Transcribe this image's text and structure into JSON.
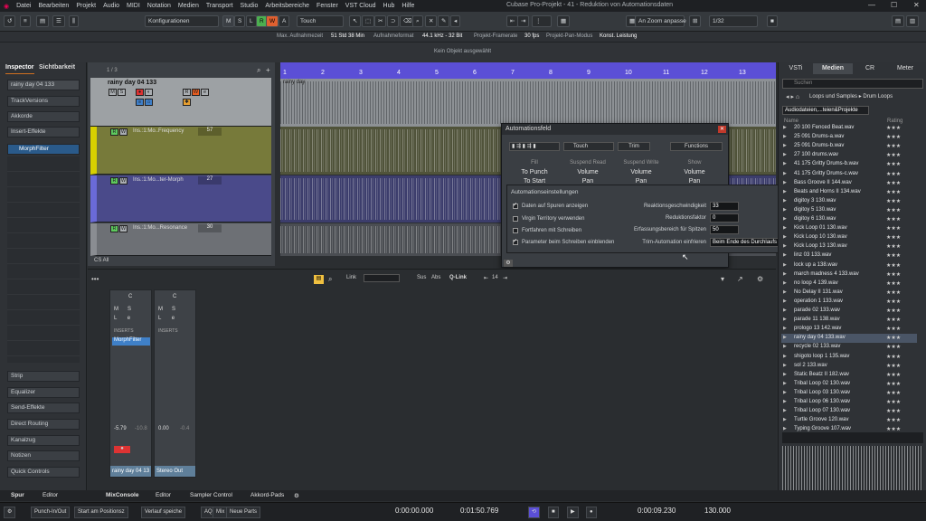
{
  "menu": {
    "items": [
      "Datei",
      "Bearbeiten",
      "Projekt",
      "Audio",
      "MIDI",
      "Notation",
      "Medien",
      "Transport",
      "Studio",
      "Arbeitsbereiche",
      "Fenster",
      "VST Cloud",
      "Hub",
      "Hilfe"
    ],
    "title": "Cubase Pro-Projekt - 41 - Reduktion von Automationsdaten"
  },
  "toolbar": {
    "config": "Konfigurationen",
    "mode_letters": [
      "M",
      "S",
      "L",
      "R",
      "W",
      "A"
    ],
    "touch": "Touch",
    "grid": "An Zoom anpasse",
    "quantize": "1/32"
  },
  "status": {
    "max_rec_label": "Max. Aufnahmezeit",
    "max_rec": "51 Std 38 Min",
    "format_label": "Aufnahmeformat",
    "format": "44.1 kHz - 32 Bit",
    "fps_label": "Projekt-Framerate",
    "fps": "30 fps",
    "pan_label": "Projekt-Pan-Modus",
    "pan": "Konst. Leistung"
  },
  "info": {
    "text": "Kein Objekt ausgewählt"
  },
  "inspector": {
    "tabs": [
      "Inspector",
      "Sichtbarkeit"
    ],
    "track_name": "rainy day 04 133",
    "sections": [
      "TrackVersions",
      "Akkorde",
      "Insert-Effekte"
    ],
    "plugin": "MorphFilter",
    "lower_sections": [
      "Strip",
      "Equalizer",
      "Send-Effekte",
      "Direct Routing",
      "Kanalzug",
      "Notizen",
      "Quick Controls"
    ]
  },
  "tracks": {
    "counter": "1 / 3",
    "main": "rainy day 04 133",
    "lanes": [
      {
        "name": "Ins.:1:Mo..Frequency",
        "value": "57"
      },
      {
        "name": "Ins.:1:Mo...ter-Morph",
        "value": "27"
      },
      {
        "name": "Ins.:1:Mo...Resonance",
        "value": "30"
      }
    ],
    "footer": "CS All"
  },
  "ruler": {
    "bars": [
      "1",
      "2",
      "3",
      "4",
      "5",
      "6",
      "7",
      "8",
      "9",
      "10",
      "11",
      "12",
      "13"
    ]
  },
  "clip_label": "rainy day",
  "automation": {
    "title": "Automationsfeld",
    "touch": "Touch",
    "trim": "Trim",
    "functions": "Functions",
    "headers": [
      "Fill",
      "Suspend Read",
      "Suspend Write",
      "Show"
    ],
    "row1": [
      "To Punch",
      "Volume",
      "Volume",
      "Volume"
    ],
    "row2": [
      "To Start",
      "Pan",
      "Pan",
      "Pan"
    ],
    "settings_title": "Automationseinstellungen",
    "checks": [
      {
        "label": "Daten auf Spuren anzeigen",
        "on": true
      },
      {
        "label": "Virgin Territory verwenden",
        "on": false
      },
      {
        "label": "Fortfahren mit Schreiben",
        "on": false
      },
      {
        "label": "Parameter beim Schreiben einblenden",
        "on": true
      }
    ],
    "fields": [
      {
        "label": "Reaktionsgeschwindigkeit",
        "value": "33"
      },
      {
        "label": "Reduktionsfaktor",
        "value": "0"
      },
      {
        "label": "Erfassungsbereich für Spitzen",
        "value": "50"
      },
      {
        "label": "Trim-Automation einfrieren",
        "value": "Beim Ende des Durchlaufs"
      }
    ]
  },
  "lower": {
    "link": "Link",
    "sus": "Sus",
    "abs": "Abs",
    "qlink": "Q-Link",
    "page": "14",
    "ch1": {
      "name": "rainy day 04 13",
      "insert": "MorphFilter",
      "vol": "-5.79",
      "peak": "-10.8",
      "pan": "C"
    },
    "ch2": {
      "name": "Stereo Out",
      "vol": "0.00",
      "peak": "-0.4",
      "pan": "C"
    },
    "inserts": "INSERTS"
  },
  "right": {
    "tabs": [
      "VSTi",
      "Medien",
      "CR",
      "Meter"
    ],
    "search": "Suchen",
    "breadcrumb": "Loops und Samples ▸ Drum Loops",
    "path": "Audiodateien,...teien&Projekte",
    "col_name": "Name",
    "col_rating": "Rating",
    "files": [
      {
        "name": "20 100 Fenced Beat.wav",
        "stars": "★★★"
      },
      {
        "name": "25 091 Drums-a.wav",
        "stars": "★★★"
      },
      {
        "name": "25 091 Drums-b.wav",
        "stars": "★★★"
      },
      {
        "name": "27 100 drums.wav",
        "stars": "★★★"
      },
      {
        "name": "41 175 Gritty Drums-b.wav",
        "stars": "★★★"
      },
      {
        "name": "41 175 Gritty Drums-c.wav",
        "stars": "★★★"
      },
      {
        "name": "Bass Groove II 144.wav",
        "stars": "★★★"
      },
      {
        "name": "Beats and Horns II 134.wav",
        "stars": "★★★"
      },
      {
        "name": "digitoy 3 130.wav",
        "stars": "★★★"
      },
      {
        "name": "digitoy 5 130.wav",
        "stars": "★★★"
      },
      {
        "name": "digitoy 6 130.wav",
        "stars": "★★★"
      },
      {
        "name": "Kick Loop 01 130.wav",
        "stars": "★★★"
      },
      {
        "name": "Kick Loop 10 130.wav",
        "stars": "★★★"
      },
      {
        "name": "Kick Loop 13 130.wav",
        "stars": "★★★"
      },
      {
        "name": "linz 03 133.wav",
        "stars": "★★★"
      },
      {
        "name": "lock up a 138.wav",
        "stars": "★★★"
      },
      {
        "name": "march madness 4 133.wav",
        "stars": "★★★"
      },
      {
        "name": "no loop 4 139.wav",
        "stars": "★★★"
      },
      {
        "name": "No Delay II 131.wav",
        "stars": "★★★"
      },
      {
        "name": "operation 1 133.wav",
        "stars": "★★★"
      },
      {
        "name": "parade 02 133.wav",
        "stars": "★★★"
      },
      {
        "name": "parade 11 138.wav",
        "stars": "★★★"
      },
      {
        "name": "prologo 13 142.wav",
        "stars": "★★★"
      },
      {
        "name": "rainy day 04 133.wav",
        "stars": "★★★"
      },
      {
        "name": "recycle 02 133.wav",
        "stars": "★★★"
      },
      {
        "name": "shigoto loop 1 135.wav",
        "stars": "★★★"
      },
      {
        "name": "sol 2 133.wav",
        "stars": "★★★"
      },
      {
        "name": "Static Beatz II 182.wav",
        "stars": "★★★"
      },
      {
        "name": "Tribal Loop 02 130.wav",
        "stars": "★★★"
      },
      {
        "name": "Tribal Loop 03 130.wav",
        "stars": "★★★"
      },
      {
        "name": "Tribal Loop 06 130.wav",
        "stars": "★★★"
      },
      {
        "name": "Tribal Loop 07 130.wav",
        "stars": "★★★"
      },
      {
        "name": "Turtle Groove 120.wav",
        "stars": "★★★"
      },
      {
        "name": "Typing Groove 107.wav",
        "stars": "★★★"
      }
    ]
  },
  "bottom_tabs": [
    "Spur",
    "Editor",
    "MixConsole",
    "Editor",
    "Sampler Control",
    "Akkord-Pads"
  ],
  "transport": {
    "punch": "Punch-In/Out",
    "start": "Start am Positionsz",
    "history": "Verlauf speiche",
    "aq": "AQ",
    "mix": "Mix",
    "newparts": "Neue Parts",
    "time1": "0:00:00.000",
    "time2": "0:01:50.769",
    "time3": "0:00:09.230",
    "tempo": "130.000"
  },
  "colors": {
    "accent": "#5b4fd6",
    "lane1": "#777a3a",
    "lane2": "#4a4a8a",
    "lane3": "#6d7075"
  }
}
